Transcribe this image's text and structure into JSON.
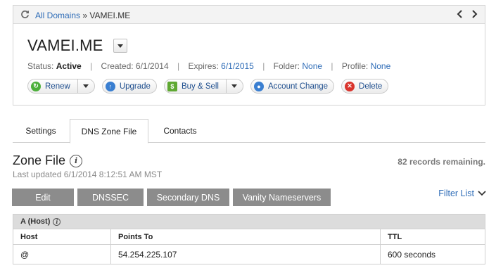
{
  "breadcrumb": {
    "root": "All Domains",
    "sep": "»",
    "current": "VAMEI.ME"
  },
  "domain": {
    "name": "VAMEI.ME",
    "status_label": "Status:",
    "status_value": "Active",
    "created": "Created: 6/1/2014",
    "expires_label": "Expires:",
    "expires_value": "6/1/2015",
    "folder_label": "Folder:",
    "folder_value": "None",
    "profile_label": "Profile:",
    "profile_value": "None"
  },
  "actions": {
    "renew": "Renew",
    "upgrade": "Upgrade",
    "buy_sell": "Buy & Sell",
    "account_change": "Account Change",
    "delete": "Delete"
  },
  "tabs": [
    "Settings",
    "DNS Zone File",
    "Contacts"
  ],
  "zone": {
    "title": "Zone File",
    "last_updated": "Last updated 6/1/2014 8:12:51 AM MST",
    "remaining": "82 records remaining.",
    "buttons": [
      "Edit",
      "DNSSEC",
      "Secondary DNS",
      "Vanity Nameservers"
    ],
    "filter": "Filter List"
  },
  "table": {
    "section": "A (Host)",
    "columns": [
      "Host",
      "Points To",
      "TTL"
    ],
    "rows": [
      {
        "host": "@",
        "points_to": "54.254.225.107",
        "ttl": "600 seconds"
      }
    ]
  },
  "colors": {
    "link": "#2e6cb7",
    "renew": "#4caf3a",
    "upgrade": "#3a7fd1",
    "buy_sell": "#5fa832",
    "account": "#3a7fd1",
    "delete": "#d9352e",
    "zone_button": "#8c8c8c"
  }
}
